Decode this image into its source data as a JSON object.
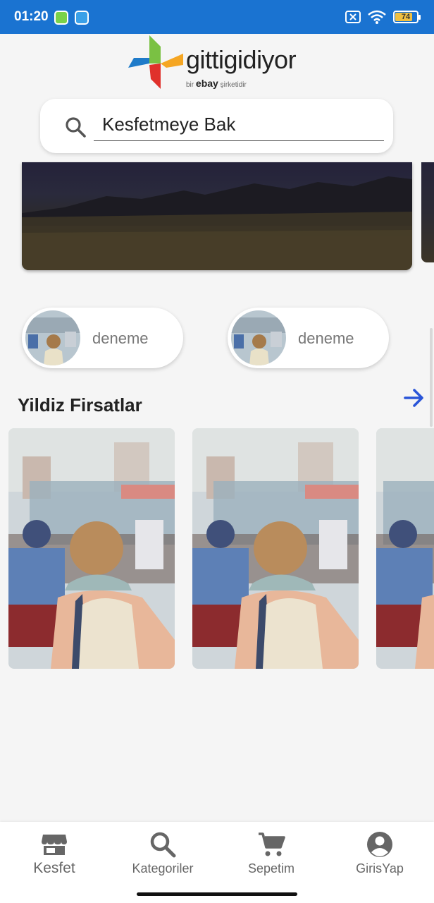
{
  "status_bar": {
    "time": "01:20",
    "battery": "74"
  },
  "brand": {
    "name": "gittigidiyor",
    "sub_prefix": "bir",
    "sub_brand": "ebay",
    "sub_suffix": "şirketidir"
  },
  "search": {
    "placeholder": "Kesfetmeye Bak"
  },
  "chips": [
    {
      "label": "deneme"
    },
    {
      "label": "deneme"
    }
  ],
  "section": {
    "title": "Yildiz Firsatlar"
  },
  "bottom_nav": [
    {
      "label": "Kesfet",
      "icon": "store-icon"
    },
    {
      "label": "Kategoriler",
      "icon": "search-icon"
    },
    {
      "label": "Sepetim",
      "icon": "cart-icon"
    },
    {
      "label": "GirisYap",
      "icon": "account-icon"
    }
  ],
  "colors": {
    "status_bar": "#1a73d1",
    "accent": "#2a55d8",
    "background": "#f5f5f5"
  }
}
